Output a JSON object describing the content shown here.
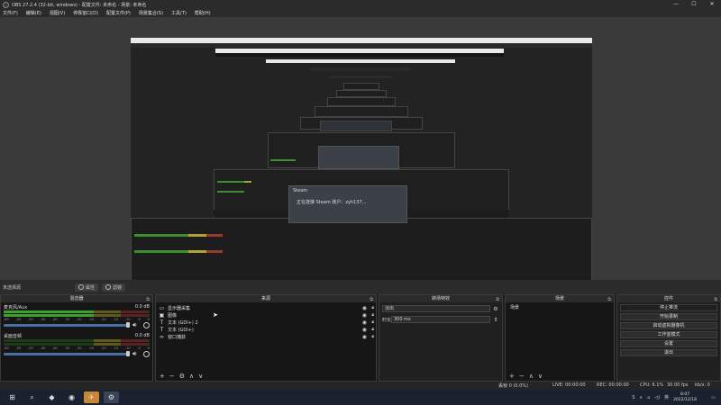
{
  "window": {
    "title": "OBS 27.2.4 (32-bit, windows) - 配置文件: 未命名 - 场景: 未命名"
  },
  "menu": {
    "items": [
      "文件(F)",
      "编辑(E)",
      "视图(V)",
      "停靠窗口(D)",
      "配置文件(P)",
      "场景集合(S)",
      "工具(T)",
      "帮助(H)"
    ]
  },
  "preview": {
    "steam_dialog": {
      "title": "Steam",
      "message": "正在连接 Steam 账户：zyh137..."
    }
  },
  "scene_toolbar": {
    "no_source": "未选择源",
    "properties_button": "属性",
    "filters_button": "滤镜"
  },
  "mixer": {
    "title": "混音器",
    "channels": [
      {
        "name": "麦克风/Aux",
        "db": "0.0 dB",
        "level": 0.62
      },
      {
        "name": "桌面音频",
        "db": "0.0 dB",
        "level": 0.0
      }
    ],
    "ticks": [
      "-60",
      "-55",
      "-50",
      "-45",
      "-40",
      "-35",
      "-30",
      "-25",
      "-20",
      "-15",
      "-10",
      "-5",
      "0"
    ]
  },
  "sources": {
    "title": "来源",
    "items": [
      {
        "icon": "▭",
        "icon_name": "display-capture-icon",
        "label": "显示器采集"
      },
      {
        "icon": "▣",
        "icon_name": "image-icon",
        "label": "图像"
      },
      {
        "icon": "T",
        "icon_name": "text-icon",
        "label": "文本 (GDI+) 2"
      },
      {
        "icon": "T",
        "icon_name": "text-icon",
        "label": "文本 (GDI+)"
      },
      {
        "icon": "∞",
        "icon_name": "infinity-icon",
        "label": "窗口捕获"
      }
    ],
    "footer": [
      "+",
      "−",
      "⚙",
      "∧",
      "∨"
    ]
  },
  "transitions": {
    "title": "转场特效",
    "type_value": "淡出",
    "duration_label": "时长",
    "duration_value": "300 ms"
  },
  "scenes": {
    "title": "场景",
    "items": [
      "场景"
    ],
    "footer": [
      "+",
      "−",
      "∧",
      "∨"
    ]
  },
  "controls": {
    "title": "控件",
    "buttons": [
      "停止推流",
      "开始录制",
      "启动虚拟摄像机",
      "工作室模式",
      "设置",
      "退出"
    ]
  },
  "status": {
    "dropped": "丢帧 0 (0.0%)",
    "live": "LIVE: 00:00:00",
    "rec": "REC: 00:00:00",
    "cpu": "CPU: 6.1%",
    "fps": "30.00 fps",
    "kbps": "kb/s: 0"
  },
  "taskbar": {
    "time": "8:07",
    "date": "2022/12/18",
    "lang": "英",
    "apps": [
      {
        "glyph": "⊞",
        "icon_name": "windows-start-icon"
      },
      {
        "glyph": "⌕",
        "icon_name": "search-icon"
      },
      {
        "glyph": "◆",
        "icon_name": "app-icon"
      },
      {
        "glyph": "◉",
        "icon_name": "chrome-icon"
      },
      {
        "glyph": "✈",
        "icon_name": "feishu-icon"
      },
      {
        "glyph": "⚙",
        "icon_name": "steam-icon"
      }
    ]
  },
  "colors": {
    "accent": "#3fa02e",
    "highlight": "#c98735",
    "panel": "#202020"
  }
}
